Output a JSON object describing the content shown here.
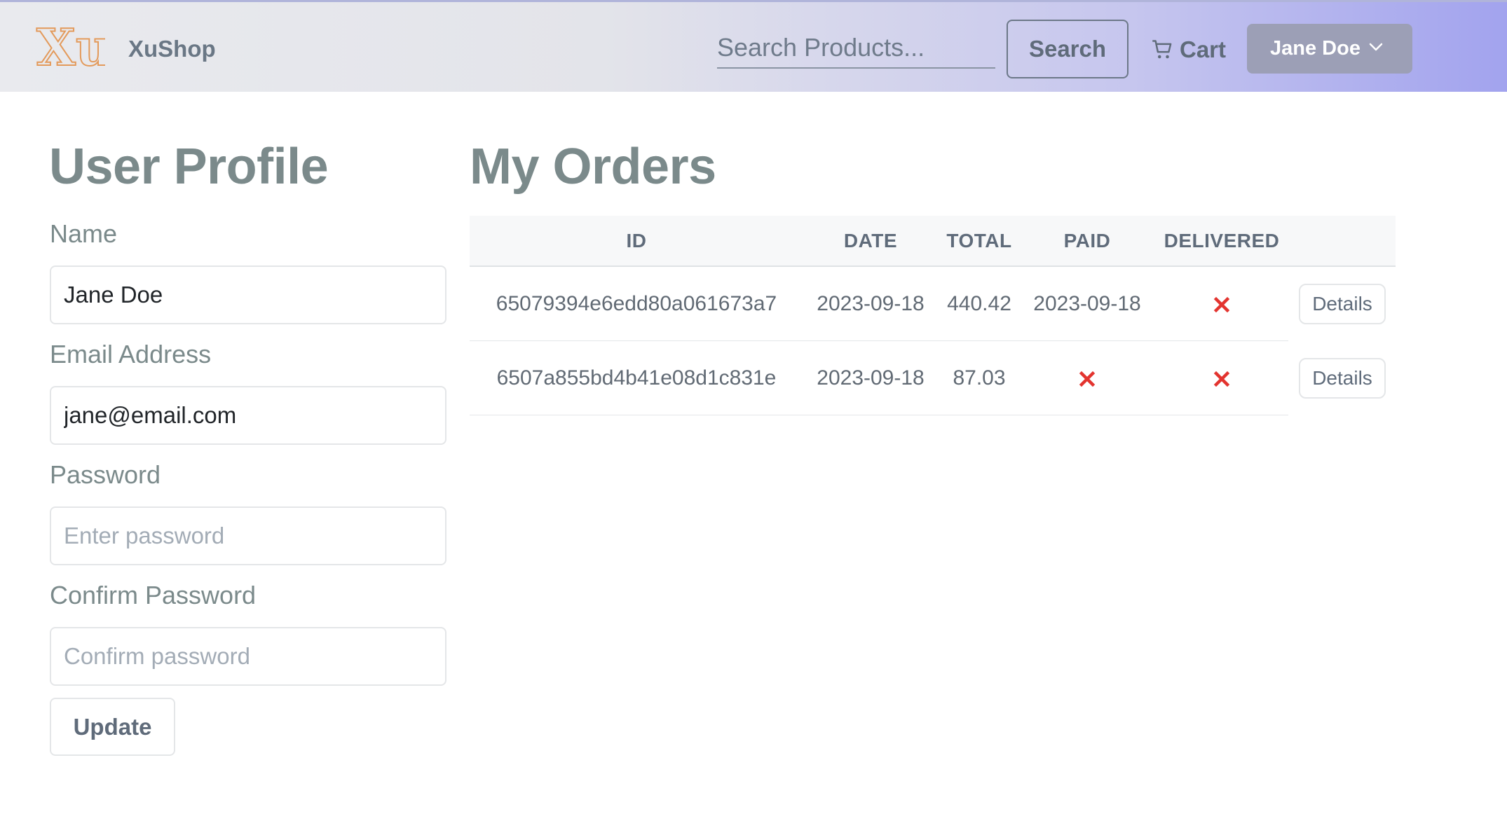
{
  "header": {
    "brand_logo_text": "Xu",
    "brand_name": "XuShop",
    "search_placeholder": "Search Products...",
    "search_button": "Search",
    "cart_label": "Cart",
    "cart_icon": "cart-icon",
    "user_name": "Jane Doe",
    "user_chevron_icon": "chevron-down-icon"
  },
  "profile": {
    "title": "User Profile",
    "name_label": "Name",
    "name_value": "Jane Doe",
    "email_label": "Email Address",
    "email_value": "jane@email.com",
    "password_label": "Password",
    "password_placeholder": "Enter password",
    "confirm_label": "Confirm Password",
    "confirm_placeholder": "Confirm password",
    "update_button": "Update"
  },
  "orders": {
    "title": "My Orders",
    "columns": [
      "ID",
      "DATE",
      "TOTAL",
      "PAID",
      "DELIVERED"
    ],
    "rows": [
      {
        "id": "65079394e6edd80a061673a7",
        "date": "2023-09-18",
        "total": "440.42",
        "paid": "2023-09-18",
        "paid_status": true,
        "delivered": false,
        "details": "Details"
      },
      {
        "id": "6507a855bd4b41e08d1c831e",
        "date": "2023-09-18",
        "total": "87.03",
        "paid": "",
        "paid_status": false,
        "delivered": false,
        "details": "Details"
      }
    ],
    "not_done_icon": "x-icon",
    "not_done_color": "#e3342f"
  },
  "colors": {
    "logo": "#e39a5b",
    "navbar_gradient_end": "#a2a3ee",
    "user_dropdown": "#9c9fb6"
  }
}
